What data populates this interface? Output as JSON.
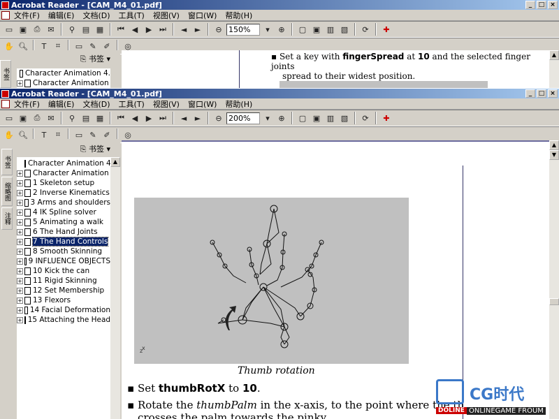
{
  "app": {
    "title": "Acrobat Reader - [CAM_M4_01.pdf]"
  },
  "menu": [
    "文件(F)",
    "编辑(E)",
    "文档(D)",
    "工具(T)",
    "视图(V)",
    "窗口(W)",
    "帮助(H)"
  ],
  "window1": {
    "zoom": "150%",
    "bookmarks_label": "书签 ▾",
    "tree": [
      "Character Animation 4.",
      "Character Animation"
    ],
    "doc_text_bold": "fingerSpread",
    "doc_value": "10",
    "doc_prefix": "Set a key with ",
    "doc_mid": " at ",
    "doc_suffix": " and the selected finger joints",
    "doc_line2": "spread to their widest position."
  },
  "window2": {
    "zoom": "200%",
    "bookmarks_label": "书签 ▾",
    "tabs": [
      "书签",
      "缩略图",
      "注释"
    ],
    "tree": [
      {
        "label": "Character Animation 4.",
        "expand": false
      },
      {
        "label": "Character Animation",
        "expand": true
      },
      {
        "label": "1 Skeleton setup",
        "expand": true
      },
      {
        "label": "2 Inverse Kinematics",
        "expand": true
      },
      {
        "label": "3 Arms and shoulders",
        "expand": true
      },
      {
        "label": "4 IK Spline solver",
        "expand": true
      },
      {
        "label": "5 Animating a walk",
        "expand": true
      },
      {
        "label": "6 The Hand Joints",
        "expand": true
      },
      {
        "label": "7 The Hand Controls",
        "expand": true,
        "selected": true
      },
      {
        "label": "8 Smooth Skinning",
        "expand": true
      },
      {
        "label": "9 INFLUENCE OBJECTS",
        "expand": true
      },
      {
        "label": "10 Kick the can",
        "expand": true
      },
      {
        "label": "11 Rigid Skinning",
        "expand": true
      },
      {
        "label": "12 Set Membership",
        "expand": true
      },
      {
        "label": "13 Flexors",
        "expand": true
      },
      {
        "label": "14 Facial Deformation",
        "expand": true
      },
      {
        "label": "15 Attaching the Head",
        "expand": true
      }
    ],
    "caption": "Thumb rotation",
    "bullet1_pre": "Set ",
    "bullet1_bold": "thumbRotX",
    "bullet1_mid": " to ",
    "bullet1_val": "10",
    "bullet1_end": ".",
    "bullet2_pre": "Rotate the ",
    "bullet2_ital": "thumbPalm",
    "bullet2_post": " in the x-axis, to the point where the th",
    "bullet2_line2": "crosses the palm towards the pinky"
  },
  "watermark": {
    "brand": "CG时代",
    "sub": "ONLINEGAME FROUM",
    "site": "DOLINE"
  }
}
